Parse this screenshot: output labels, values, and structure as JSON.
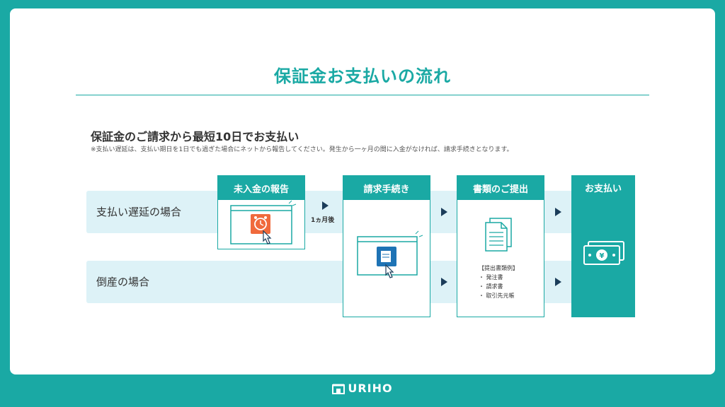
{
  "title": "保証金お支払いの流れ",
  "subtitle": "保証金のご請求から最短10日でお支払い",
  "note": "※支払い遅延は、支払い期日を1日でも過ぎた場合にネットから報告してください。発生から一ヶ月の間に入金がなければ、請求手続きとなります。",
  "rows": [
    {
      "label": "支払い遅延の場合"
    },
    {
      "label": "倒産の場合"
    }
  ],
  "steps": {
    "report": "未入金の報告",
    "claim": "請求手続き",
    "documents": "書類のご提出",
    "payment": "お支払い"
  },
  "arrow_label": "1ヵ月後",
  "documents_examples": {
    "heading": "【提出書類例】",
    "items": [
      "・ 発注書",
      "・ 請求書",
      "・ 取引先元帳"
    ]
  },
  "footer": {
    "brand": "URIHO"
  },
  "colors": {
    "teal": "#1aa9a4",
    "band": "#ddf2f7",
    "arrow": "#1b3d5a",
    "alert": "#f06a3c",
    "claim_icon": "#1e73b5"
  }
}
